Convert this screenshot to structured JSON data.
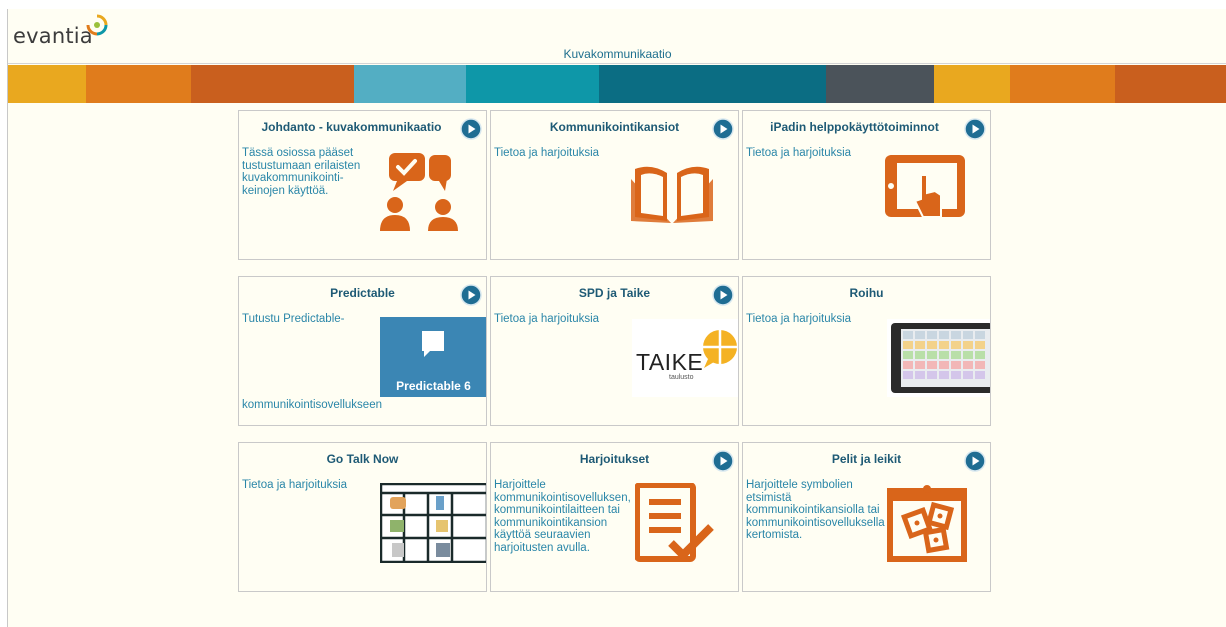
{
  "header": {
    "logo_text": "evantia",
    "page_title": "Kuvakommunikaatio"
  },
  "stripe_colors": [
    "#e9a81f",
    "#e07c1c",
    "#c95f1e",
    "#53aec3",
    "#0e97a8",
    "#0b6d83",
    "#4b535a",
    "#e9a81f",
    "#e07c1c",
    "#c95f1e"
  ],
  "colors": {
    "accent_orange": "#d9651a",
    "title_blue": "#1e5a75",
    "text_blue": "#2a86a8",
    "play_button": "#1f6d93"
  },
  "cards": [
    {
      "title": "Johdanto - kuvakommunikaatio",
      "desc": "Tässä osiossa pääset tustustumaan erilaisten kuvakommunikointi-keinojen käyttöä.",
      "has_play": true,
      "icon": "people-chat-icon"
    },
    {
      "title": "Kommunikointikansiot",
      "desc": "Tietoa ja harjoituksia",
      "has_play": true,
      "icon": "open-book-icon"
    },
    {
      "title": "iPadin helppokäyttötoiminnot",
      "desc": "Tietoa ja harjoituksia",
      "has_play": true,
      "icon": "tablet-touch-icon"
    },
    {
      "title": "Predictable",
      "desc": "Tutustu Predictable-",
      "desc_bottom": "kommunikointisovellukseen",
      "has_play": true,
      "image_label": "Predictable 6",
      "icon": "predictable-logo"
    },
    {
      "title": "SPD ja Taike",
      "desc": "Tietoa ja harjoituksia",
      "has_play": true,
      "image_label": "TAIKE",
      "image_sub": "taulusto",
      "icon": "taike-logo"
    },
    {
      "title": "Roihu",
      "desc": "Tietoa ja harjoituksia",
      "has_play": false,
      "icon": "tablet-device-image"
    },
    {
      "title": "Go Talk Now",
      "desc": "Tietoa ja harjoituksia",
      "has_play": false,
      "icon": "symbol-grid-image"
    },
    {
      "title": "Harjoitukset",
      "desc": "Harjoittele kommunikointisovelluksen, kommunikointilaitteen tai kommunikointikansion käyttöä seuraavien harjoitusten avulla.",
      "has_play": true,
      "icon": "checklist-icon"
    },
    {
      "title": "Pelit ja leikit",
      "desc": "Harjoittele symbolien etsimistä kommunikointikansiolla tai kommunikointisovelluksella kertomista.",
      "has_play": true,
      "icon": "puzzle-board-icon"
    }
  ]
}
